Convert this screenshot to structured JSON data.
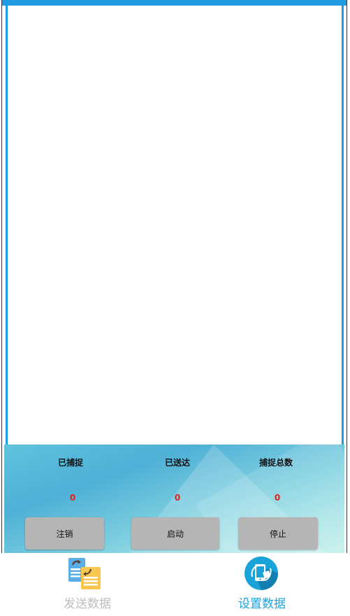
{
  "stats": {
    "captured_label": "已捕捉",
    "sent_label": "已送达",
    "total_label": "捕捉总数",
    "captured_value": "0",
    "sent_value": "0",
    "total_value": "0"
  },
  "buttons": {
    "logout_label": "注销",
    "start_label": "启动",
    "stop_label": "停止"
  },
  "nav": {
    "items": [
      {
        "label": "发送数据",
        "icon": "send-data-icon",
        "active": false
      },
      {
        "label": "设置数据",
        "icon": "settings-data-icon",
        "active": true
      }
    ]
  },
  "colors": {
    "accent": "#1f9be3",
    "active_nav": "#1aa3e0",
    "inactive_nav": "#bdbdbd",
    "value_red": "#e0211a",
    "button_gray": "#b5b5b5"
  }
}
